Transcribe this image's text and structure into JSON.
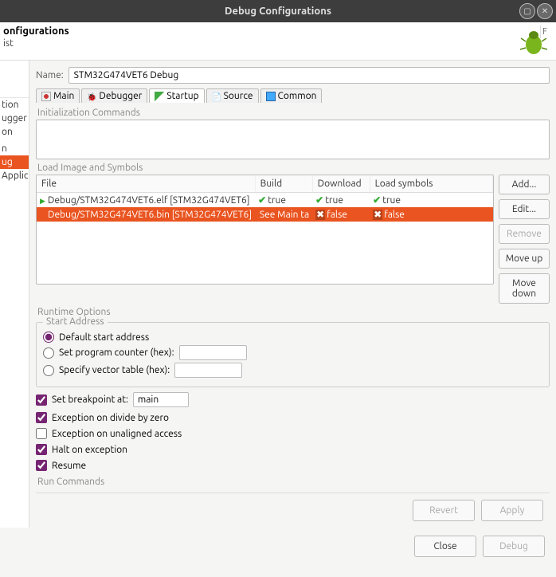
{
  "window": {
    "title": "Debug Configurations",
    "minimize": "▢",
    "close": "✕"
  },
  "header": {
    "title": "onfigurations",
    "subtitle": "ist"
  },
  "sidebar": {
    "items": [
      {
        "label": "tion"
      },
      {
        "label": "ugger"
      },
      {
        "label": "on"
      },
      {
        "label": ""
      },
      {
        "label": "n"
      },
      {
        "label": "ug",
        "selected": true
      },
      {
        "label": "Applic"
      }
    ]
  },
  "name_field": {
    "label": "Name:",
    "value": "STM32G474VET6 Debug"
  },
  "tabs": [
    {
      "label": "Main"
    },
    {
      "label": "Debugger"
    },
    {
      "label": "Startup",
      "active": true
    },
    {
      "label": "Source"
    },
    {
      "label": "Common"
    }
  ],
  "sections": {
    "init": "Initialization Commands",
    "load": "Load Image and Symbols",
    "runtime": "Runtime Options",
    "runcmd": "Run Commands",
    "startaddr": "Start Address"
  },
  "table": {
    "headers": {
      "file": "File",
      "build": "Build",
      "download": "Download",
      "load": "Load symbols"
    },
    "rows": [
      {
        "file": "Debug/STM32G474VET6.elf [STM32G474VET6]",
        "build": "true",
        "download": "true",
        "load": "true",
        "ok": true
      },
      {
        "file": "Debug/STM32G474VET6.bin [STM32G474VET6]",
        "build": "See Main ta",
        "download": "false",
        "load": "false",
        "ok": false,
        "selected": true
      }
    ]
  },
  "sidebtns": {
    "add": "Add...",
    "edit": "Edit...",
    "remove": "Remove",
    "up": "Move up",
    "down": "Move down"
  },
  "start_address": {
    "default": "Default start address",
    "pc": "Set program counter (hex):",
    "vt": "Specify vector table (hex):",
    "pc_val": "",
    "vt_val": ""
  },
  "options": {
    "bp_label": "Set breakpoint at:",
    "bp_value": "main",
    "divzero": "Exception on divide by zero",
    "unaligned": "Exception on unaligned access",
    "halt": "Halt on exception",
    "resume": "Resume"
  },
  "footer": {
    "revert": "Revert",
    "apply": "Apply",
    "close": "Close",
    "debug": "Debug"
  },
  "far_right": "F"
}
